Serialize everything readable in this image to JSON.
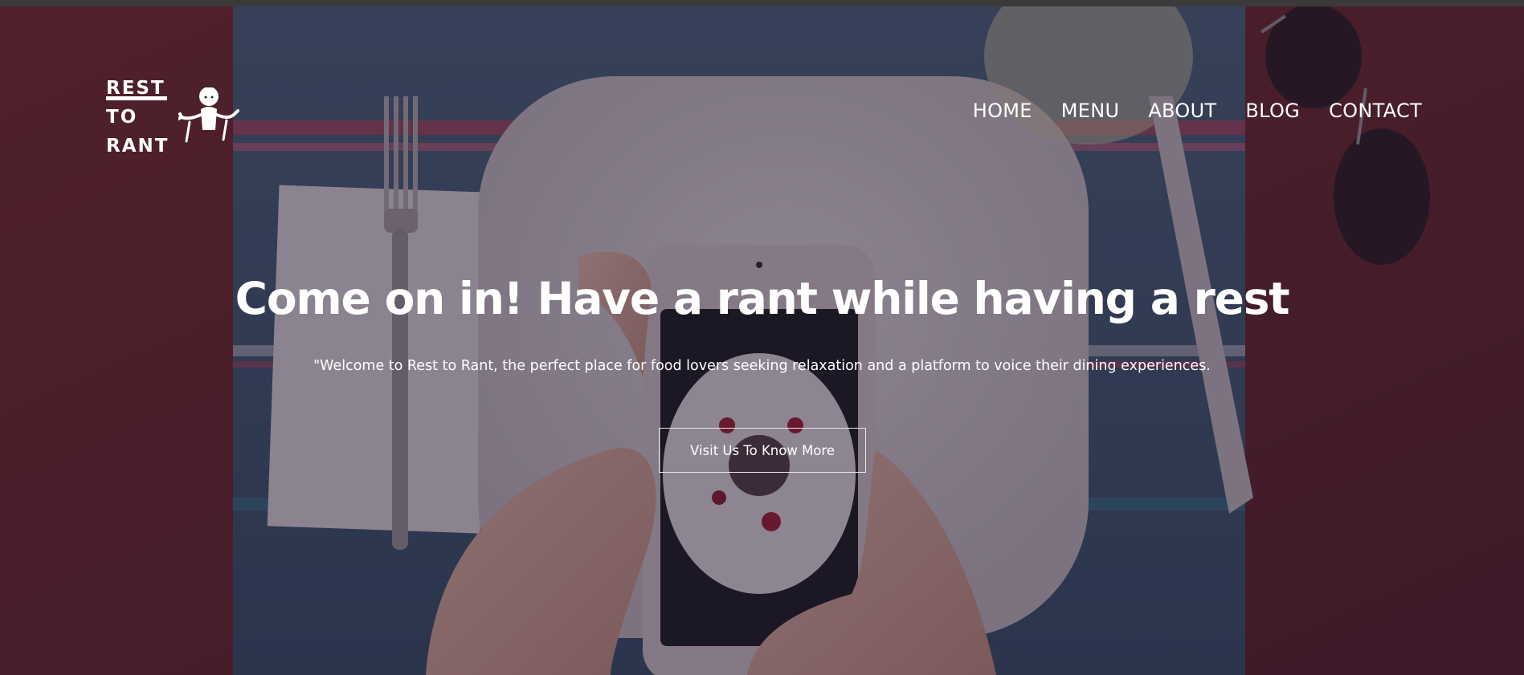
{
  "brand": {
    "logo_lines": [
      "REST",
      "TO",
      "RANT"
    ]
  },
  "nav": {
    "items": [
      {
        "label": "HOME"
      },
      {
        "label": "MENU"
      },
      {
        "label": "ABOUT"
      },
      {
        "label": "BLOG"
      },
      {
        "label": "CONTACT"
      }
    ]
  },
  "hero": {
    "headline": "Come on in! Have a rant while having a rest",
    "subtext": "\"Welcome to Rest to Rant, the perfect place for food lovers seeking relaxation and a platform to voice their dining experiences.",
    "cta_label": "Visit Us To Know More"
  },
  "colors": {
    "text": "#ffffff",
    "overlay": "#1e0f23",
    "button_border": "#e8e8e8",
    "table_wood": "#6b2a2e",
    "placemat_blue": "#3e5b74",
    "plate": "#d9d6dc"
  },
  "icons": {
    "logo_figure": "waving-person-icon"
  }
}
